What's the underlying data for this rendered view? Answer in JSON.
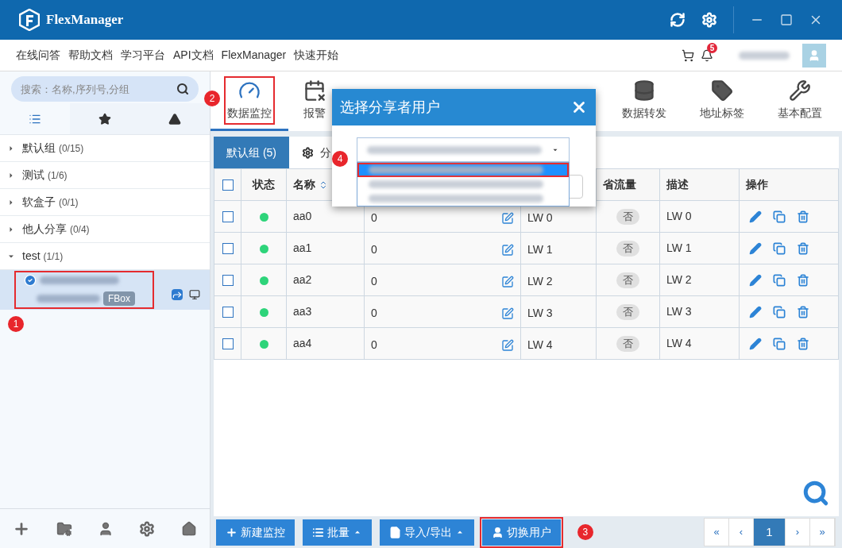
{
  "app": {
    "title": "FlexManager"
  },
  "links": [
    "在线问答",
    "帮助文档",
    "学习平台",
    "API文档",
    "FlexManager",
    "快速开始"
  ],
  "notifications": {
    "count": "5"
  },
  "sidebar": {
    "search": {
      "placeholder": "搜索：名称,序列号,分组"
    },
    "tabs": [
      {
        "kind": "list",
        "selected": true
      },
      {
        "kind": "star",
        "selected": false
      },
      {
        "kind": "alert",
        "selected": false
      }
    ],
    "groups": [
      {
        "label": "默认组",
        "count": "(0/15)",
        "expanded": false
      },
      {
        "label": "测试",
        "count": "(1/6)",
        "expanded": false
      },
      {
        "label": "软盒子",
        "count": "(0/1)",
        "expanded": false
      },
      {
        "label": "他人分享",
        "count": "(0/4)",
        "expanded": false
      },
      {
        "label": "test",
        "count": "(1/1)",
        "expanded": true,
        "children": [
          {
            "tag": "FBox",
            "online": true,
            "selected": true,
            "highlighted": true,
            "marker": "1"
          }
        ]
      }
    ]
  },
  "toolbar": [
    {
      "kind": "monitor",
      "label": "数据监控",
      "selected": true,
      "highlighted": true,
      "marker": "2"
    },
    {
      "kind": "alarm",
      "label": "报警",
      "selected": false,
      "highlighted": false
    },
    {
      "kind": "forward",
      "label": "数据转发",
      "selected": false,
      "highlighted": false
    },
    {
      "kind": "tag",
      "label": "地址标签",
      "selected": false,
      "highlighted": false
    },
    {
      "kind": "config",
      "label": "基本配置",
      "selected": false,
      "highlighted": false
    }
  ],
  "group_tabs": [
    {
      "label": "默认组 (5)",
      "selected": true
    },
    {
      "label": "分",
      "selected": false
    }
  ],
  "table": {
    "header_checked": false,
    "headers": {
      "status": "状态",
      "name": "名称",
      "traffic": "省流量",
      "desc": "描述",
      "ops": "操作"
    },
    "rows": [
      {
        "checked": false,
        "online": true,
        "name": "aa0",
        "value": "0",
        "address": "LW 0",
        "traffic": "否",
        "desc": "LW 0"
      },
      {
        "checked": false,
        "online": true,
        "name": "aa1",
        "value": "0",
        "address": "LW 1",
        "traffic": "否",
        "desc": "LW 1"
      },
      {
        "checked": false,
        "online": true,
        "name": "aa2",
        "value": "0",
        "address": "LW 2",
        "traffic": "否",
        "desc": "LW 2"
      },
      {
        "checked": false,
        "online": true,
        "name": "aa3",
        "value": "0",
        "address": "LW 3",
        "traffic": "否",
        "desc": "LW 3"
      },
      {
        "checked": false,
        "online": true,
        "name": "aa4",
        "value": "0",
        "address": "LW 4",
        "traffic": "否",
        "desc": "LW 4"
      }
    ]
  },
  "bottom_buttons": [
    {
      "kind": "add",
      "label": "新建监控",
      "highlighted": false
    },
    {
      "kind": "batch",
      "label": "批量",
      "highlighted": false
    },
    {
      "kind": "file",
      "label": "导入/导出",
      "highlighted": false
    },
    {
      "kind": "user",
      "label": "切换用户",
      "highlighted": true,
      "marker": "3"
    }
  ],
  "pagination": [
    {
      "label": "«",
      "selected": false
    },
    {
      "label": "‹",
      "selected": false
    },
    {
      "label": "1",
      "selected": true
    },
    {
      "label": "›",
      "selected": false
    },
    {
      "label": "»",
      "selected": false
    }
  ],
  "modal": {
    "title": "选择分享者用户",
    "marker": "4",
    "options": [
      {
        "selected": true,
        "highlighted": true
      },
      {
        "selected": false,
        "highlighted": false
      },
      {
        "selected": false,
        "highlighted": false
      }
    ]
  }
}
